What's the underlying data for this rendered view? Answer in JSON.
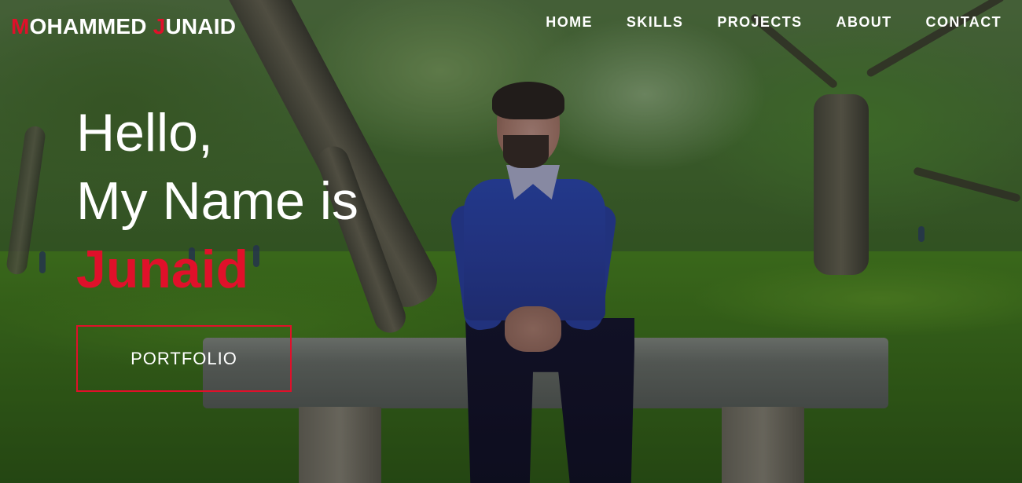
{
  "nav": {
    "logo": {
      "first_initial": "M",
      "first_rest": "OHAMMED",
      "last_initial": "J",
      "last_rest": "UNAID"
    },
    "items": [
      {
        "label": "HOME"
      },
      {
        "label": "SKILLS"
      },
      {
        "label": "PROJECTS"
      },
      {
        "label": "ABOUT"
      },
      {
        "label": "CONTACT"
      }
    ]
  },
  "hero": {
    "greeting": "Hello,",
    "intro": "My Name is",
    "name": "Junaid",
    "cta_label": "PORTFOLIO",
    "background_image": "park-bench-portrait-photo"
  },
  "colors": {
    "accent": "#e0102a",
    "text": "#ffffff"
  }
}
